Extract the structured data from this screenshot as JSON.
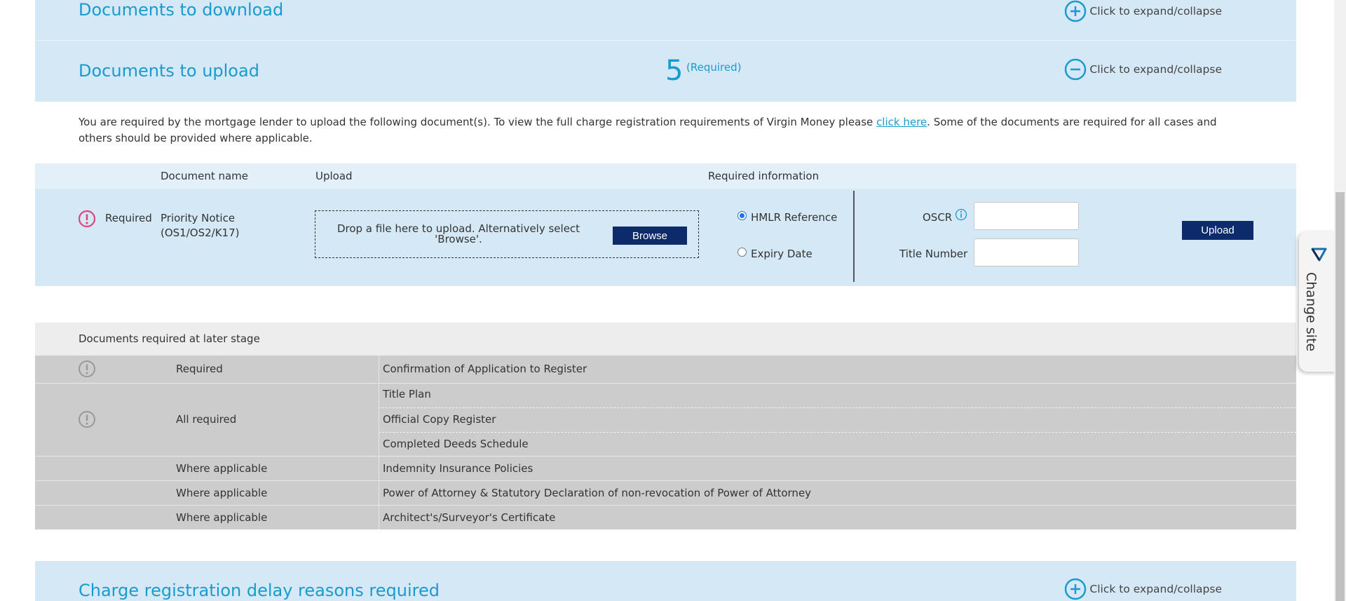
{
  "sections": {
    "download": {
      "title": "Documents to download",
      "toggle_label": "Click to expand/collapse"
    },
    "upload": {
      "title": "Documents to upload",
      "count": "5",
      "count_label": "(Required)",
      "toggle_label": "Click to expand/collapse"
    },
    "delay": {
      "title": "Charge registration delay reasons required",
      "toggle_label": "Click to expand/collapse"
    }
  },
  "intro": {
    "text_before": "You are required by the mortgage lender to upload the following document(s). To view the full charge registration requirements of Virgin Money please ",
    "link": "click here",
    "text_after": ". Some of the documents are required for all cases and others should be provided where applicable."
  },
  "upload_table": {
    "headers": {
      "document_name": "Document name",
      "upload": "Upload",
      "required_info": "Required information"
    },
    "row": {
      "status": "Required",
      "doc_name_line1": "Priority Notice",
      "doc_name_line2": "(OS1/OS2/K17)",
      "drop_text_line1": "Drop a file here to upload. Alternatively select",
      "drop_text_line2": "'Browse'.",
      "browse_label": "Browse",
      "radio_hmlr": "HMLR Reference",
      "radio_expiry": "Expiry Date",
      "oscr_label": "OSCR",
      "title_number_label": "Title Number",
      "oscr_value": "",
      "title_number_value": "",
      "upload_label": "Upload"
    }
  },
  "later_stage": {
    "heading": "Documents required at later stage",
    "rows": [
      {
        "status": "Required",
        "documents": [
          "Confirmation of Application to Register"
        ]
      },
      {
        "status": "All required",
        "documents": [
          "Title Plan",
          "Official Copy Register",
          "Completed Deeds Schedule"
        ]
      },
      {
        "status": "Where applicable",
        "documents": [
          "Indemnity Insurance Policies"
        ]
      },
      {
        "status": "Where applicable",
        "documents": [
          "Power of Attorney & Statutory Declaration of non-revocation of Power of Attorney"
        ]
      },
      {
        "status": "Where applicable",
        "documents": [
          "Architect's/Surveyor's Certificate"
        ]
      }
    ]
  },
  "change_site": {
    "label": "Change site"
  },
  "colors": {
    "accent": "#1a9bd0",
    "header_bg": "#d5e8f6",
    "navy": "#0d2b6b",
    "alert_pink": "#e0457b",
    "later_bg": "#cccccc"
  }
}
